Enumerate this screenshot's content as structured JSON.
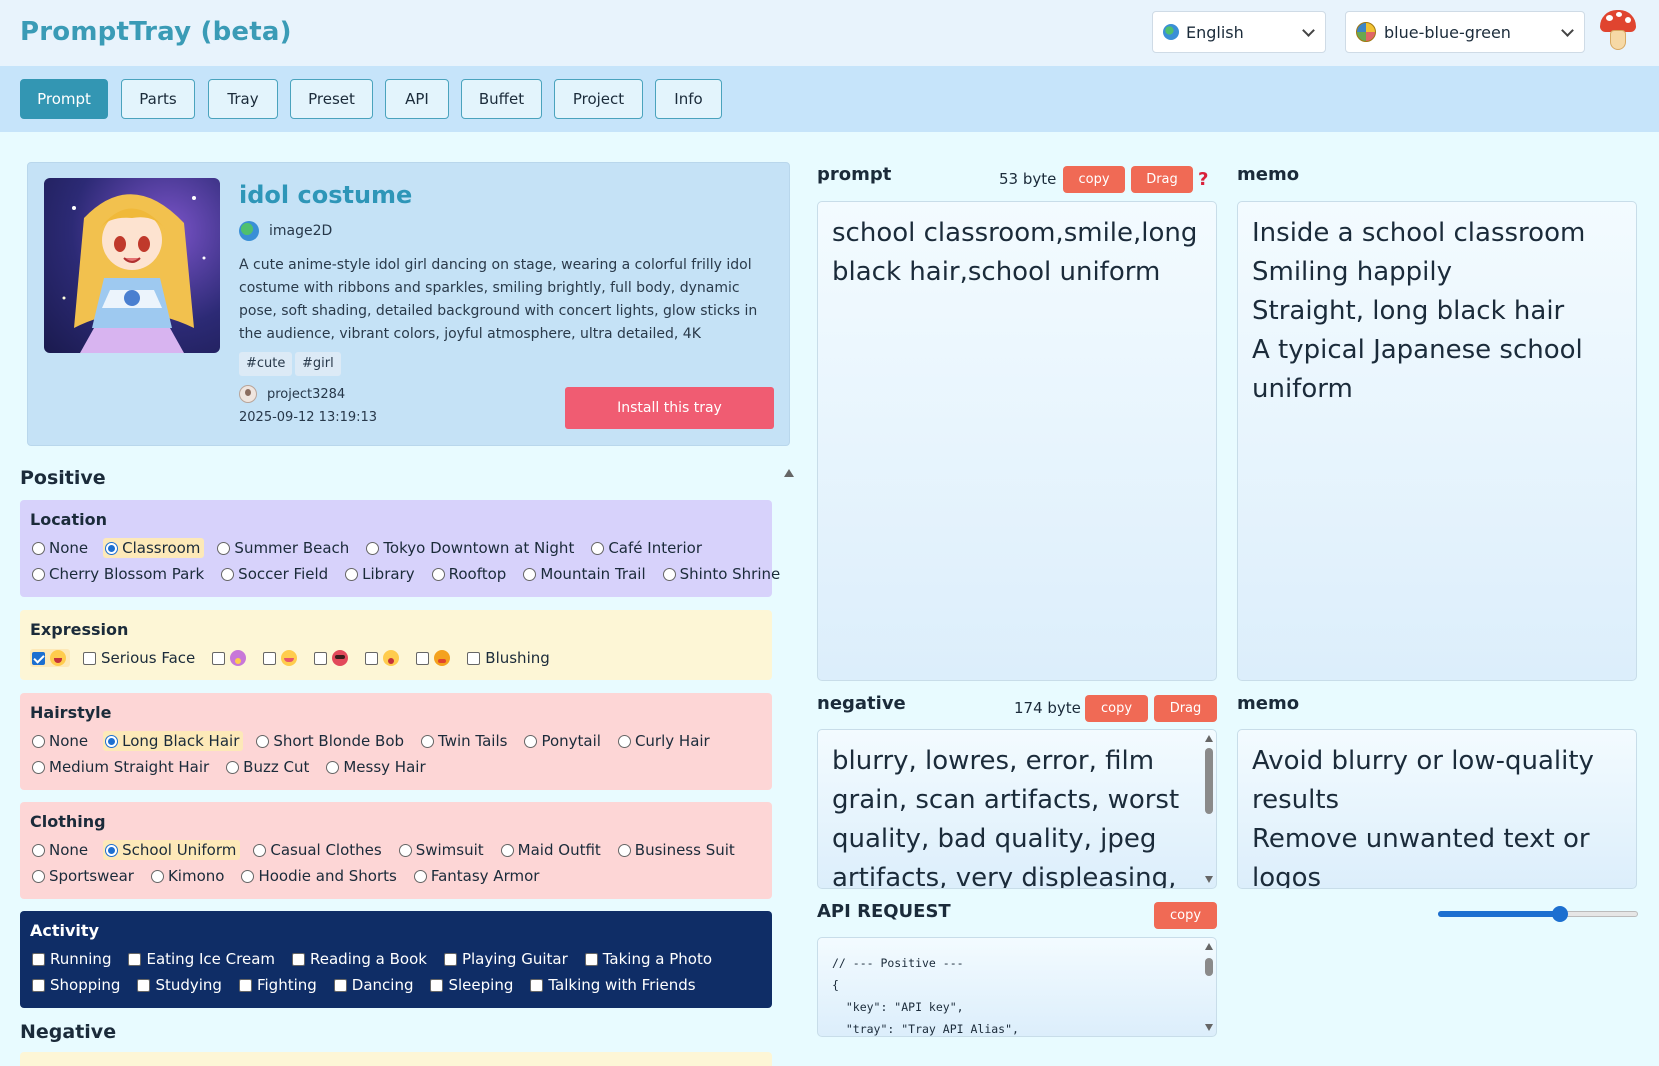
{
  "app": {
    "title": "PromptTray (beta)"
  },
  "language_select": {
    "value": "English"
  },
  "theme_select": {
    "value": "blue-blue-green"
  },
  "tabs": [
    {
      "label": "Prompt",
      "active": true
    },
    {
      "label": "Parts"
    },
    {
      "label": "Tray"
    },
    {
      "label": "Preset"
    },
    {
      "label": "API"
    },
    {
      "label": "Buffet"
    },
    {
      "label": "Project"
    },
    {
      "label": "Info"
    }
  ],
  "tray": {
    "title": "idol costume",
    "category": "image2D",
    "description": "A cute anime-style idol girl dancing on stage, wearing a colorful frilly idol costume with ribbons and sparkles, smiling brightly, full body, dynamic pose, soft shading, detailed background with concert lights, glow sticks in the audience, vibrant colors, joyful atmosphere, ultra detailed, 4K",
    "tags": [
      "#cute",
      "#girl"
    ],
    "author": "project3284",
    "date": "2025-09-12 13:19:13",
    "install_label": "Install this tray"
  },
  "positive_heading": "Positive",
  "negative_heading": "Negative",
  "groups": {
    "location": {
      "title": "Location",
      "color": "#d7d2fb",
      "row1": [
        "None",
        "Classroom",
        "Summer Beach",
        "Tokyo Downtown at Night",
        "Café Interior"
      ],
      "row2": [
        "Cherry Blossom Park",
        "Soccer Field",
        "Library",
        "Rooftop",
        "Mountain Trail",
        "Shinto Shrine"
      ],
      "selected": "Classroom"
    },
    "expression": {
      "title": "Expression",
      "color": "#fdf6d6",
      "items": [
        {
          "emoji": "laughing-face-icon",
          "checked": true
        },
        {
          "label": "Serious Face"
        },
        {
          "emoji": "sad-face-icon"
        },
        {
          "emoji": "grinning-face-icon"
        },
        {
          "emoji": "angry-face-icon"
        },
        {
          "emoji": "surprised-face-icon"
        },
        {
          "emoji": "sleepy-face-icon"
        },
        {
          "label": "Blushing"
        }
      ]
    },
    "hairstyle": {
      "title": "Hairstyle",
      "color": "#fdd6d6",
      "row1": [
        "None",
        "Long Black Hair",
        "Short Blonde Bob",
        "Twin Tails",
        "Ponytail",
        "Curly Hair"
      ],
      "row2": [
        "Medium Straight Hair",
        "Buzz Cut",
        "Messy Hair"
      ],
      "selected": "Long Black Hair"
    },
    "clothing": {
      "title": "Clothing",
      "color": "#fdd6d6",
      "row1": [
        "None",
        "School Uniform",
        "Casual Clothes",
        "Swimsuit",
        "Maid Outfit",
        "Business Suit"
      ],
      "row2": [
        "Sportswear",
        "Kimono",
        "Hoodie and Shorts",
        "Fantasy Armor"
      ],
      "selected": "School Uniform"
    },
    "activity": {
      "title": "Activity",
      "color": "#0f2d66",
      "row1": [
        "Running",
        "Eating Ice Cream",
        "Reading a Book",
        "Playing Guitar",
        "Taking a Photo"
      ],
      "row2": [
        "Shopping",
        "Studying",
        "Fighting",
        "Dancing",
        "Sleeping",
        "Talking with Friends"
      ]
    }
  },
  "prompt_pane": {
    "label": "prompt",
    "bytes": "53 byte",
    "copy_label": "copy",
    "drag_label": "Drag",
    "help_label": "?",
    "text": "school classroom,smile,long black hair,school uniform"
  },
  "memo_pane": {
    "label": "memo",
    "text": "Inside a school classroom\nSmiling happily\nStraight, long black hair\nA typical Japanese school uniform"
  },
  "negative_pane": {
    "label": "negative",
    "bytes": "174 byte",
    "copy_label": "copy",
    "drag_label": "Drag",
    "text": "blurry, lowres, error, film grain, scan artifacts, worst quality, bad quality, jpeg artifacts, very displeasing, dated, signature,"
  },
  "negative_memo_pane": {
    "label": "memo",
    "text": "Avoid blurry or low-quality results\nRemove unwanted text or logos"
  },
  "api_pane": {
    "label": "API REQUEST",
    "copy_label": "copy",
    "code": "// --- Positive ---\n{\n  \"key\": \"API key\",\n  \"tray\": \"Tray API Alias\","
  },
  "slider": {
    "value": 0.62
  }
}
